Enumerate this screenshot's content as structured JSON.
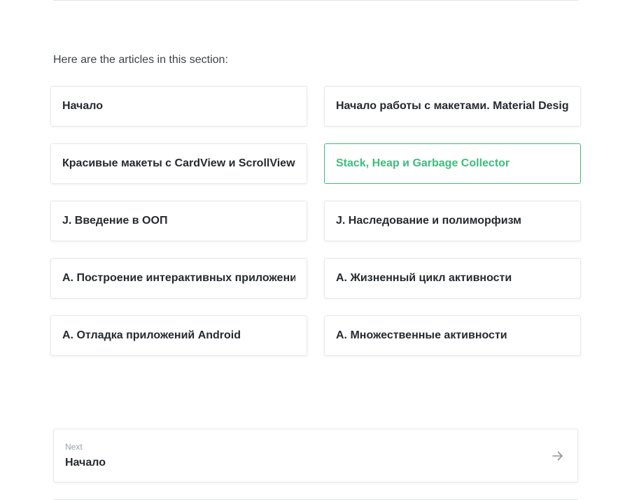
{
  "section": {
    "intro": "Here are the articles in this section:"
  },
  "articles": [
    {
      "label": "Начало",
      "active": false
    },
    {
      "label": "Начало работы с макетами. Material Design",
      "active": false
    },
    {
      "label": "Красивые макеты с CardView и ScrollView",
      "active": false
    },
    {
      "label": "Stack, Heap и Garbage Collector",
      "active": true
    },
    {
      "label": "J. Введение в ООП",
      "active": false
    },
    {
      "label": "J. Наследование и полиморфизм",
      "active": false
    },
    {
      "label": "A. Построение интерактивных приложений",
      "active": false
    },
    {
      "label": "A. Жизненный цикл активности",
      "active": false
    },
    {
      "label": "A. Отладка приложений Android",
      "active": false
    },
    {
      "label": "A. Множественные активности",
      "active": false
    }
  ],
  "next": {
    "kicker": "Next",
    "title": "Начало",
    "icon": "arrow-right-icon"
  },
  "colors": {
    "accent": "#3dbd7d",
    "border": "#e6e8eb",
    "text": "#262a2f",
    "muted": "#9aa1a9"
  }
}
